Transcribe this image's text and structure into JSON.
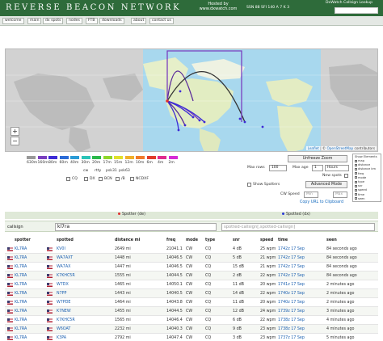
{
  "header": {
    "logo": "REVERSE BEACON NETWORK",
    "hosted_line1": "Hosted by",
    "hosted_line2": "www.dxwatch.com",
    "solar": "SSN 88 SFI 140 A 7 K 3",
    "dx_lookup_label": "DxWatch Callsign Lookup"
  },
  "nav": [
    "welcome",
    "main",
    "dx spots",
    "nodes",
    "FTB",
    "downloads",
    "about",
    "contact us"
  ],
  "map": {
    "zoom_in": "+",
    "zoom_out": "−",
    "attribution_leaflet": "Leaflet",
    "attribution_sep": " | © ",
    "attribution_osm": "OpenStreetMap",
    "attribution_tail": " contributors"
  },
  "bands": [
    {
      "label": "630m",
      "color": "#999999"
    },
    {
      "label": "160m",
      "color": "#7a3fbf"
    },
    {
      "label": "80m",
      "color": "#3d2bd6"
    },
    {
      "label": "60m",
      "color": "#2b6bd6"
    },
    {
      "label": "40m",
      "color": "#2b9bd6"
    },
    {
      "label": "30m",
      "color": "#2bc4b8"
    },
    {
      "label": "20m",
      "color": "#2bb84a"
    },
    {
      "label": "17m",
      "color": "#8fd62b"
    },
    {
      "label": "15m",
      "color": "#e0e02b"
    },
    {
      "label": "12m",
      "color": "#f0b02b"
    },
    {
      "label": "10m",
      "color": "#f07a2b"
    },
    {
      "label": "6m",
      "color": "#e03b2b"
    },
    {
      "label": "4m",
      "color": "#e02b8f"
    },
    {
      "label": "2m",
      "color": "#d62bd6"
    }
  ],
  "modes_row1": [
    "cw",
    "rtty",
    "psk31",
    "psk63"
  ],
  "modes_row2": [
    "CQ",
    "DX",
    "BCN",
    "/B",
    "NCDXF"
  ],
  "controls": {
    "unfreeze": "Unfreeze Zoom",
    "max_rows_label": "Max rows",
    "max_rows_value": "100",
    "max_age_label": "Max age",
    "max_age_value": "1",
    "max_age_unit": "Hours",
    "new_spots_label": "New spots",
    "show_spotters": "Show Spotters",
    "advanced": "Advanced Mode",
    "cw_speed_label": "CW Speed",
    "cw_min": "Min",
    "cw_max": "Max",
    "copy_link": "Copy URL to Clipboard"
  },
  "show_elements": {
    "title": "Show Elements",
    "items": [
      "map",
      "distance",
      "distance km",
      "freq",
      "mode",
      "type",
      "snr",
      "speed",
      "time",
      "seen"
    ]
  },
  "roles": {
    "spotter": "Spotter (de)",
    "spotted": "Spotted (dx)",
    "spotter_color": "#e03030",
    "spotted_color": "#2b3bd6"
  },
  "callsign": {
    "label": "callsign",
    "value": "kl7ra",
    "spotted_placeholder": "spotted-callsign[,spotted-callsign]"
  },
  "columns": [
    "spotter",
    "spotted",
    "distance mi",
    "freq",
    "mode",
    "type",
    "snr",
    "speed",
    "time",
    "seen"
  ],
  "rows": [
    {
      "spotter": "KL7RA",
      "spotted": "KV0I",
      "distance": "2649 mi",
      "freq": "21041.1",
      "mode": "CW",
      "type": "CQ",
      "snr": "4 dB",
      "speed": "25 wpm",
      "time": "1742z 17 Sep",
      "seen": "84 seconds ago"
    },
    {
      "spotter": "KL7RA",
      "spotted": "WA7AXT",
      "distance": "1448 mi",
      "freq": "14046.5",
      "mode": "CW",
      "type": "CQ",
      "snr": "5 dB",
      "speed": "21 wpm",
      "time": "1742z 17 Sep",
      "seen": "84 seconds ago"
    },
    {
      "spotter": "KL7RA",
      "spotted": "WA7AX",
      "distance": "1447 mi",
      "freq": "14046.5",
      "mode": "CW",
      "type": "CQ",
      "snr": "15 dB",
      "speed": "21 wpm",
      "time": "1742z 17 Sep",
      "seen": "84 seconds ago"
    },
    {
      "spotter": "KL7RA",
      "spotted": "K7KHC5R",
      "distance": "1555 mi",
      "freq": "14044.5",
      "mode": "CW",
      "type": "CQ",
      "snr": "2 dB",
      "speed": "22 wpm",
      "time": "1742z 17 Sep",
      "seen": "84 seconds ago"
    },
    {
      "spotter": "KL7RA",
      "spotted": "W7DX",
      "distance": "1465 mi",
      "freq": "14050.1",
      "mode": "CW",
      "type": "CQ",
      "snr": "11 dB",
      "speed": "20 wpm",
      "time": "1741z 17 Sep",
      "seen": "2 minutes ago"
    },
    {
      "spotter": "KL7RA",
      "spotted": "N7PP",
      "distance": "1443 mi",
      "freq": "14040.5",
      "mode": "CW",
      "type": "CQ",
      "snr": "14 dB",
      "speed": "22 wpm",
      "time": "1740z 17 Sep",
      "seen": "2 minutes ago"
    },
    {
      "spotter": "KL7RA",
      "spotted": "W7PDE",
      "distance": "1464 mi",
      "freq": "14043.8",
      "mode": "CW",
      "type": "CQ",
      "snr": "11 dB",
      "speed": "20 wpm",
      "time": "1740z 17 Sep",
      "seen": "2 minutes ago"
    },
    {
      "spotter": "KL7RA",
      "spotted": "K7NEW",
      "distance": "1455 mi",
      "freq": "14044.5",
      "mode": "CW",
      "type": "CQ",
      "snr": "12 dB",
      "speed": "24 wpm",
      "time": "1739z 17 Sep",
      "seen": "3 minutes ago"
    },
    {
      "spotter": "KL7RA",
      "spotted": "K7KHC5R",
      "distance": "1565 mi",
      "freq": "14046.4",
      "mode": "CW",
      "type": "CQ",
      "snr": "6 dB",
      "speed": "22 wpm",
      "time": "1738z 17 Sep",
      "seen": "4 minutes ago"
    },
    {
      "spotter": "KL7RA",
      "spotted": "W6OAT",
      "distance": "2232 mi",
      "freq": "14040.3",
      "mode": "CW",
      "type": "CQ",
      "snr": "9 dB",
      "speed": "23 wpm",
      "time": "1738z 17 Sep",
      "seen": "4 minutes ago"
    },
    {
      "spotter": "KL7RA",
      "spotted": "K3PA",
      "distance": "2792 mi",
      "freq": "14047.4",
      "mode": "CW",
      "type": "CQ",
      "snr": "3 dB",
      "speed": "23 wpm",
      "time": "1737z 17 Sep",
      "seen": "5 minutes ago"
    }
  ]
}
